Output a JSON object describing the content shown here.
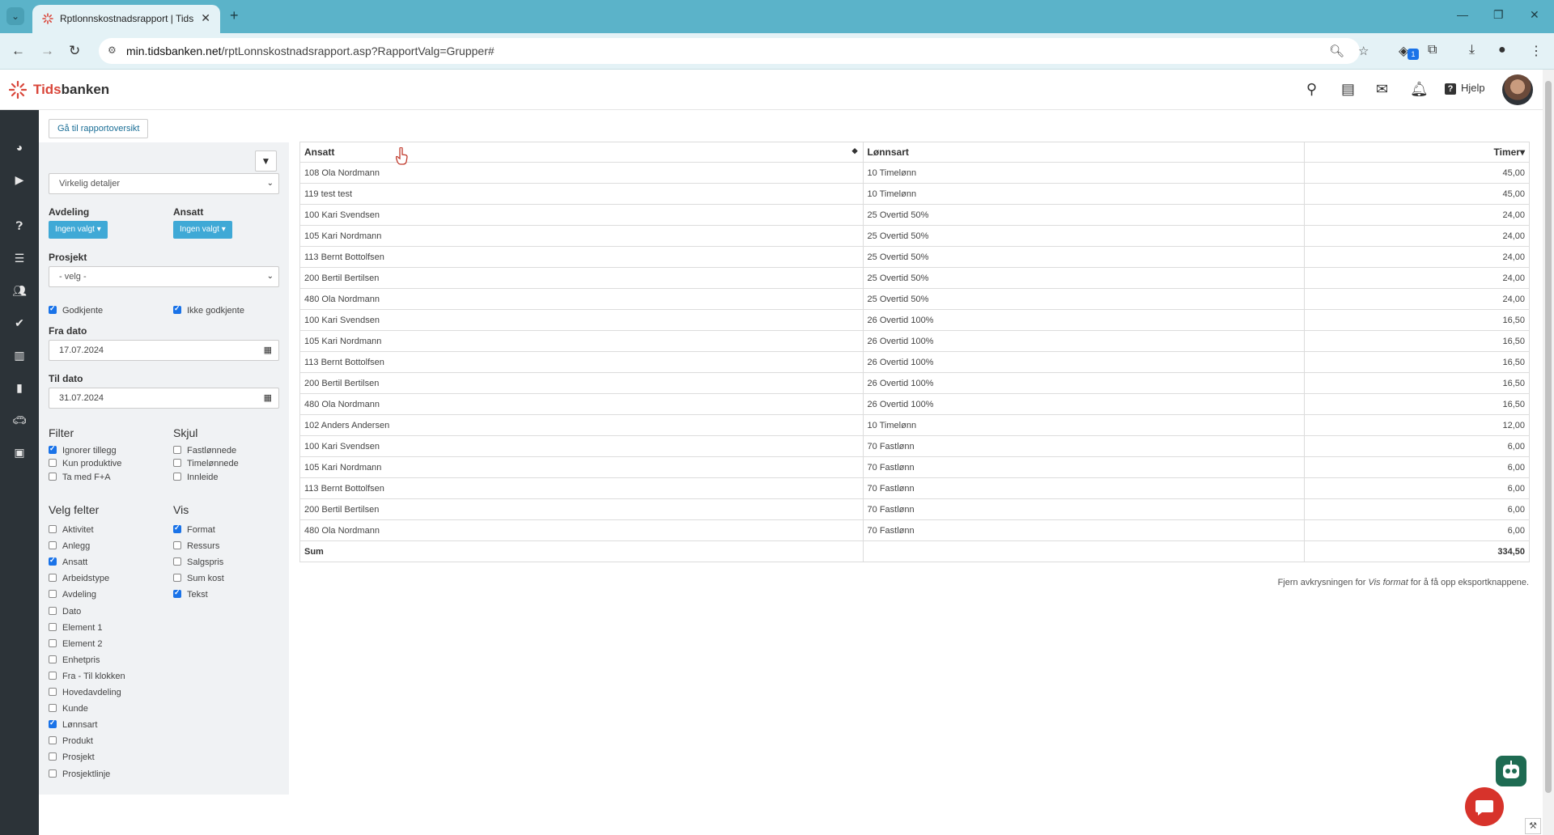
{
  "browser": {
    "tab_title": "Rptlonnskostnadsrapport | Tids",
    "url_domain": "min.tidsbanken.net",
    "url_path": "/rptLonnskostnadsrapport.asp?RapportValg=Grupper#",
    "extension_badge": "1"
  },
  "header": {
    "logo_accent": "Tids",
    "logo_rest": "banken",
    "help_label": "Hjelp"
  },
  "panel": {
    "overview_button": "Gå til rapportoversikt",
    "report_type": "Virkelig detaljer",
    "department_label": "Avdeling",
    "employee_label": "Ansatt",
    "none_selected": "Ingen valgt ▾",
    "project_label": "Prosjekt",
    "project_value": "- velg -",
    "approved_label": "Godkjente",
    "not_approved_label": "Ikke godkjente",
    "from_date_label": "Fra dato",
    "from_date": "17.07.2024",
    "to_date_label": "Til dato",
    "to_date": "31.07.2024",
    "filter_title": "Filter",
    "filter_items": [
      "Ignorer tillegg",
      "Kun produktive",
      "Ta med F+A"
    ],
    "hide_title": "Skjul",
    "hide_items": [
      "Fastlønnede",
      "Timelønnede",
      "Innleide"
    ],
    "fields_title": "Velg felter",
    "fields_items": [
      "Aktivitet",
      "Anlegg",
      "Ansatt",
      "Arbeidstype",
      "Avdeling",
      "Dato",
      "Element 1",
      "Element 2",
      "Enhetpris",
      "Fra - Til klokken",
      "Hovedavdeling",
      "Kunde",
      "Lønnsart",
      "Produkt",
      "Prosjekt",
      "Prosjektlinje"
    ],
    "show_title": "Vis",
    "show_items": [
      "Format",
      "Ressurs",
      "Salgspris",
      "Sum kost",
      "Tekst"
    ]
  },
  "table": {
    "columns": [
      "Ansatt",
      "Lønnsart",
      "Timer"
    ],
    "rows": [
      [
        "108 Ola Nordmann",
        "10 Timelønn",
        "45,00"
      ],
      [
        "119 test test",
        "10 Timelønn",
        "45,00"
      ],
      [
        "100 Kari Svendsen",
        "25 Overtid 50%",
        "24,00"
      ],
      [
        "105 Kari Nordmann",
        "25 Overtid 50%",
        "24,00"
      ],
      [
        "113 Bernt Bottolfsen",
        "25 Overtid 50%",
        "24,00"
      ],
      [
        "200 Bertil Bertilsen",
        "25 Overtid 50%",
        "24,00"
      ],
      [
        "480 Ola Nordmann",
        "25 Overtid 50%",
        "24,00"
      ],
      [
        "100 Kari Svendsen",
        "26 Overtid 100%",
        "16,50"
      ],
      [
        "105 Kari Nordmann",
        "26 Overtid 100%",
        "16,50"
      ],
      [
        "113 Bernt Bottolfsen",
        "26 Overtid 100%",
        "16,50"
      ],
      [
        "200 Bertil Bertilsen",
        "26 Overtid 100%",
        "16,50"
      ],
      [
        "480 Ola Nordmann",
        "26 Overtid 100%",
        "16,50"
      ],
      [
        "102 Anders Andersen",
        "10 Timelønn",
        "12,00"
      ],
      [
        "100 Kari Svendsen",
        "70 Fastlønn",
        "6,00"
      ],
      [
        "105 Kari Nordmann",
        "70 Fastlønn",
        "6,00"
      ],
      [
        "113 Bernt Bottolfsen",
        "70 Fastlønn",
        "6,00"
      ],
      [
        "200 Bertil Bertilsen",
        "70 Fastlønn",
        "6,00"
      ],
      [
        "480 Ola Nordmann",
        "70 Fastlønn",
        "6,00"
      ]
    ],
    "sum_label": "Sum",
    "sum_value": "334,50"
  },
  "export_note": {
    "before": "Fjern avkrysningen for ",
    "emph": "Vis format",
    "after": " for å få opp eksportknappene."
  },
  "colors": {
    "chrome_tab_bar": "#5bb3c9",
    "left_nav": "#2c3338",
    "accent_blue": "#3fa9d6",
    "logo_red": "#d9463a"
  }
}
